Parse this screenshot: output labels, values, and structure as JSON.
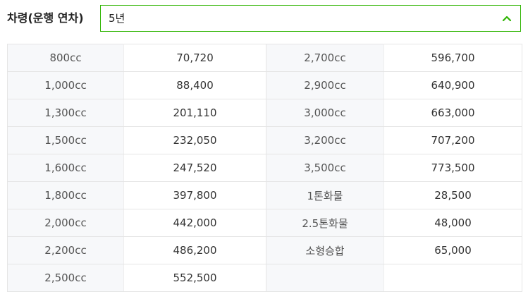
{
  "filter": {
    "label": "차령(운행 연차)",
    "selected": "5년",
    "accent_color": "#2db400",
    "toggle_icon": "chevron-up-icon"
  },
  "table": {
    "rows": [
      [
        "800cc",
        "70,720",
        "2,700cc",
        "596,700"
      ],
      [
        "1,000cc",
        "88,400",
        "2,900cc",
        "640,900"
      ],
      [
        "1,300cc",
        "201,110",
        "3,000cc",
        "663,000"
      ],
      [
        "1,500cc",
        "232,050",
        "3,200cc",
        "707,200"
      ],
      [
        "1,600cc",
        "247,520",
        "3,500cc",
        "773,500"
      ],
      [
        "1,800cc",
        "397,800",
        "1톤화물",
        "28,500"
      ],
      [
        "2,000cc",
        "442,000",
        "2.5톤화물",
        "48,000"
      ],
      [
        "2,200cc",
        "486,200",
        "소형승합",
        "65,000"
      ],
      [
        "2,500cc",
        "552,500",
        "",
        ""
      ]
    ]
  }
}
